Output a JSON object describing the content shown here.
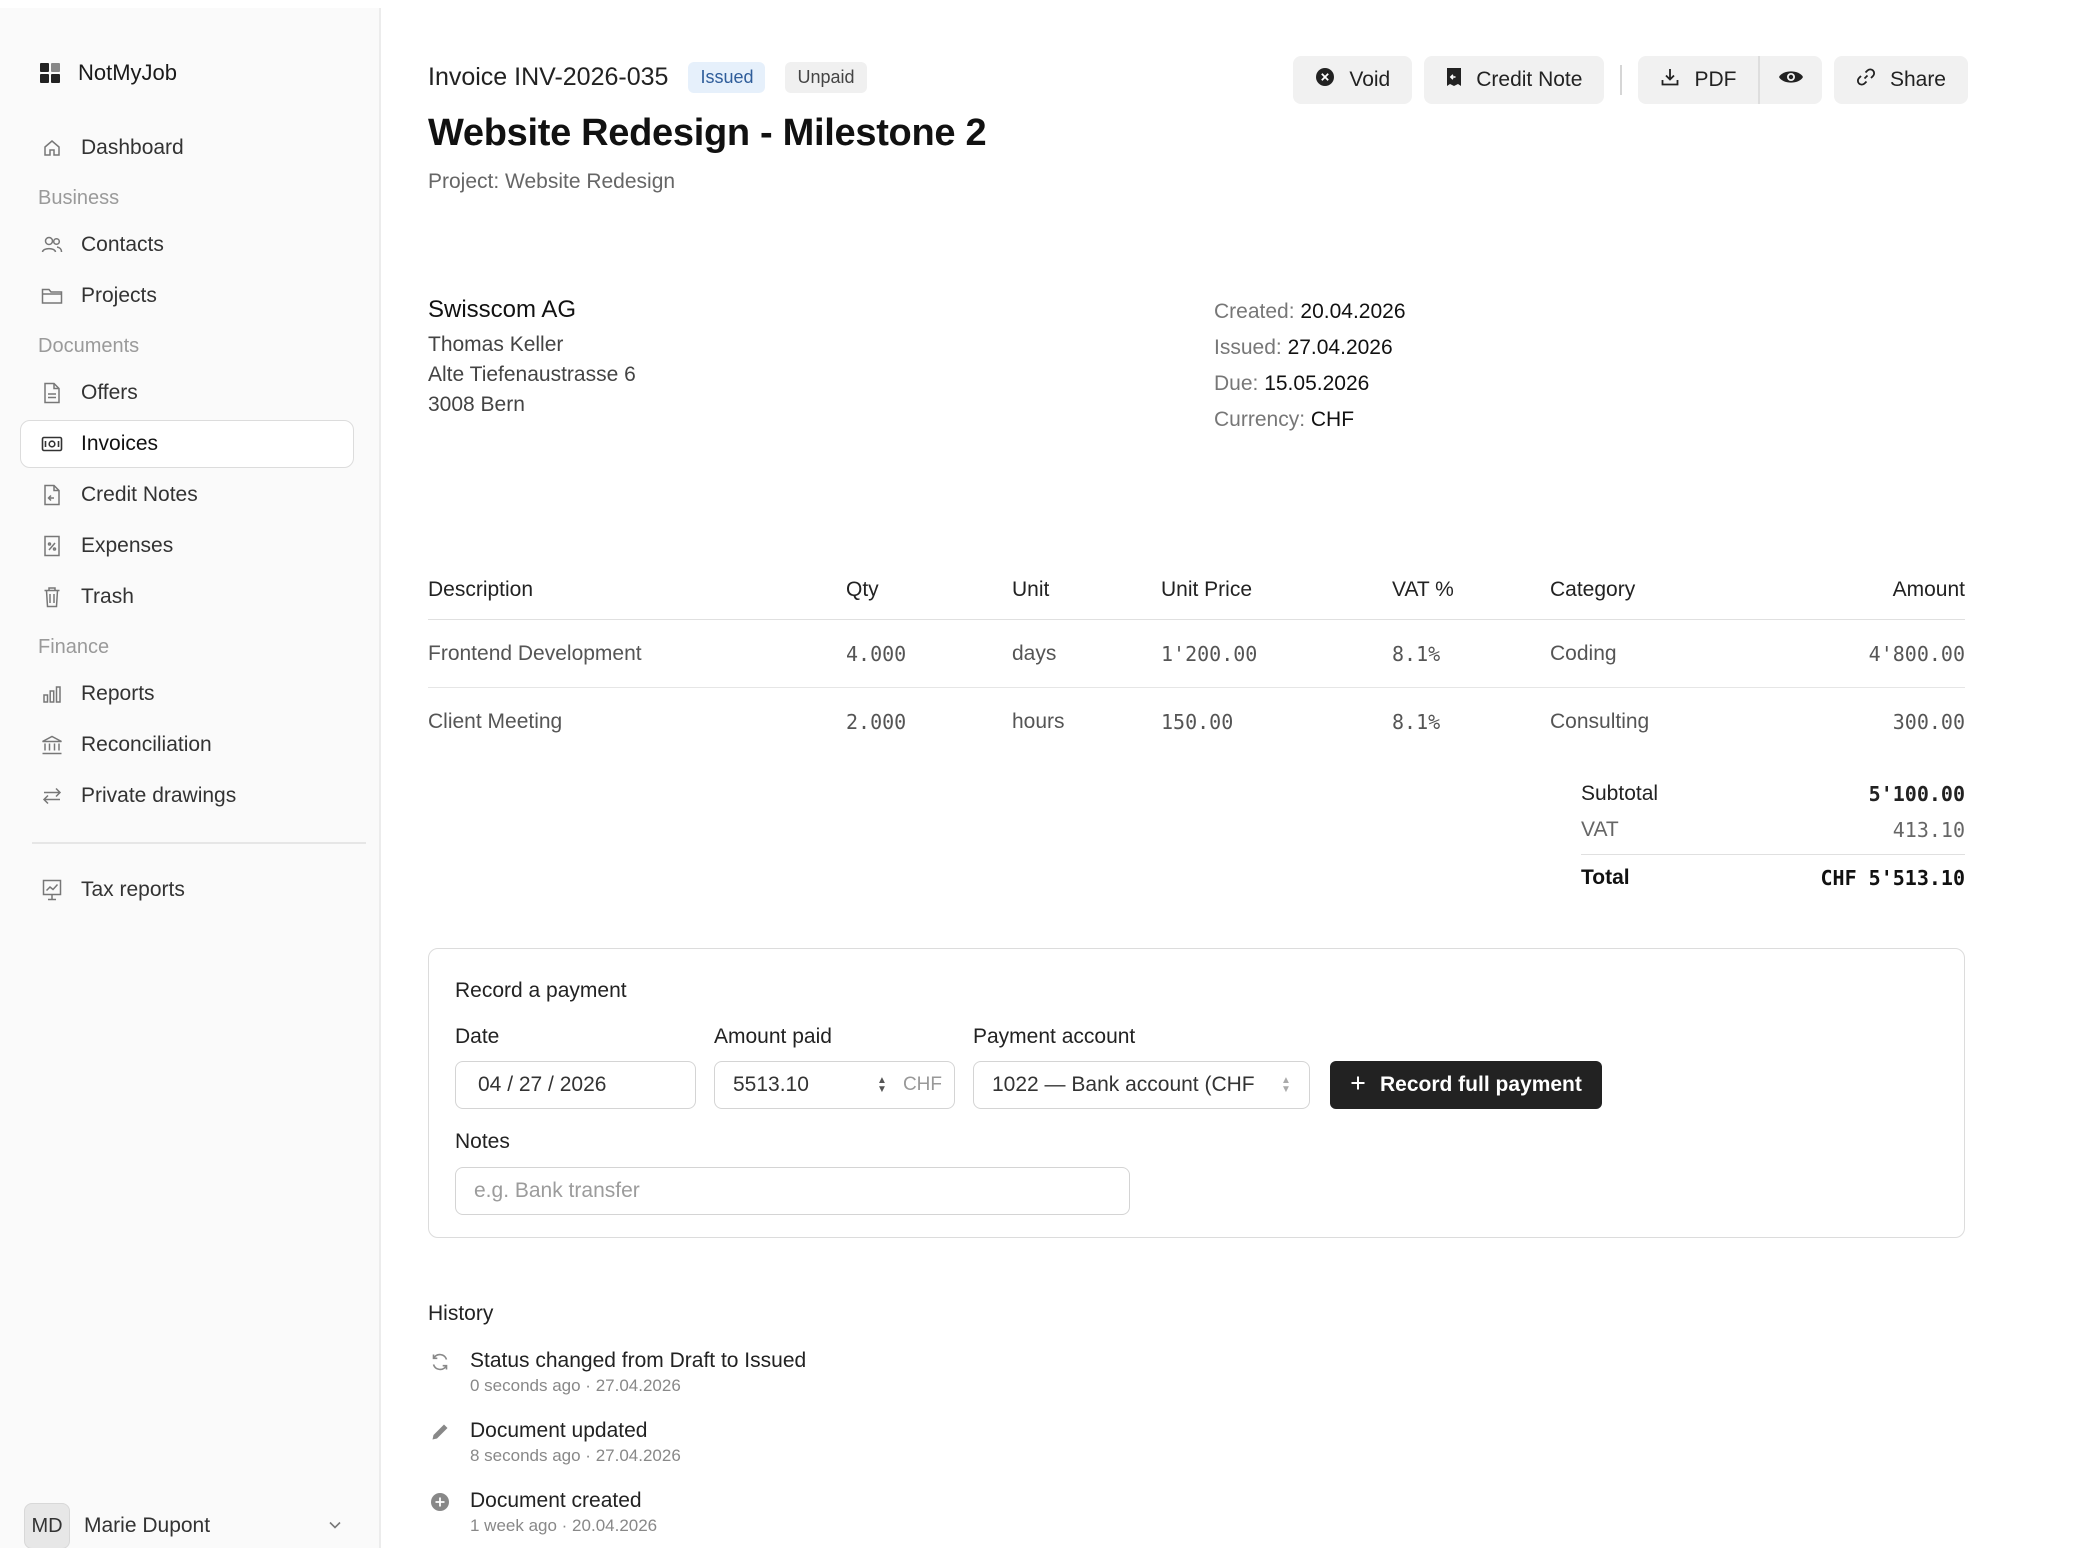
{
  "app": {
    "name": "NotMyJob"
  },
  "sidebar": {
    "dashboard": "Dashboard",
    "section_business": "Business",
    "contacts": "Contacts",
    "projects": "Projects",
    "section_documents": "Documents",
    "offers": "Offers",
    "invoices": "Invoices",
    "credit_notes": "Credit Notes",
    "expenses": "Expenses",
    "trash": "Trash",
    "section_finance": "Finance",
    "reports": "Reports",
    "reconciliation": "Reconciliation",
    "private_drawings": "Private drawings",
    "tax_reports": "Tax reports",
    "active_item": "invoices"
  },
  "user": {
    "initials": "MD",
    "name": "Marie Dupont"
  },
  "invoice": {
    "number": "Invoice INV-2026-035",
    "status_badge": "Issued",
    "payment_badge": "Unpaid",
    "title": "Website Redesign - Milestone 2",
    "project": "Project: Website Redesign"
  },
  "toolbar": {
    "void": "Void",
    "credit_note": "Credit Note",
    "pdf": "PDF",
    "share": "Share"
  },
  "client": {
    "company": "Swisscom AG",
    "contact": "Thomas Keller",
    "street": "Alte Tiefenaustrasse 6",
    "city": "3008 Bern"
  },
  "meta": {
    "created_label": "Created:",
    "created": "20.04.2026",
    "issued_label": "Issued:",
    "issued": "27.04.2026",
    "due_label": "Due:",
    "due": "15.05.2026",
    "currency_label": "Currency:",
    "currency": "CHF"
  },
  "table": {
    "headers": [
      "Description",
      "Qty",
      "Unit",
      "Unit Price",
      "VAT %",
      "Category",
      "Amount"
    ],
    "rows": [
      [
        "Frontend Development",
        "4.000",
        "days",
        "1'200.00",
        "8.1%",
        "Coding",
        "4'800.00"
      ],
      [
        "Client Meeting",
        "2.000",
        "hours",
        "150.00",
        "8.1%",
        "Consulting",
        "300.00"
      ]
    ]
  },
  "totals": {
    "subtotal_label": "Subtotal",
    "subtotal": "5'100.00",
    "vat_label": "VAT",
    "vat": "413.10",
    "total_label": "Total",
    "total": "CHF 5'513.10"
  },
  "payment": {
    "title": "Record a payment",
    "date_label": "Date",
    "date_value": "04 / 27 / 2026",
    "amount_label": "Amount paid",
    "amount_value": "5513.10",
    "amount_suffix": "CHF",
    "account_label": "Payment account",
    "account_value": "1022 — Bank account (CHF",
    "record_button": "Record full payment",
    "notes_label": "Notes",
    "notes_placeholder": "e.g. Bank transfer"
  },
  "history": {
    "title": "History",
    "items": [
      {
        "icon": "refresh-icon",
        "title": "Status changed from Draft to Issued",
        "sub": "0 seconds ago · 27.04.2026"
      },
      {
        "icon": "pencil-icon",
        "title": "Document updated",
        "sub": "8 seconds ago · 27.04.2026"
      },
      {
        "icon": "plus-circle-icon",
        "title": "Document created",
        "sub": "1 week ago · 20.04.2026"
      }
    ]
  },
  "colors": {
    "badge_issued_bg": "#e6f0fb",
    "badge_issued_text": "#2f5d9a",
    "primary_button": "#222222"
  }
}
